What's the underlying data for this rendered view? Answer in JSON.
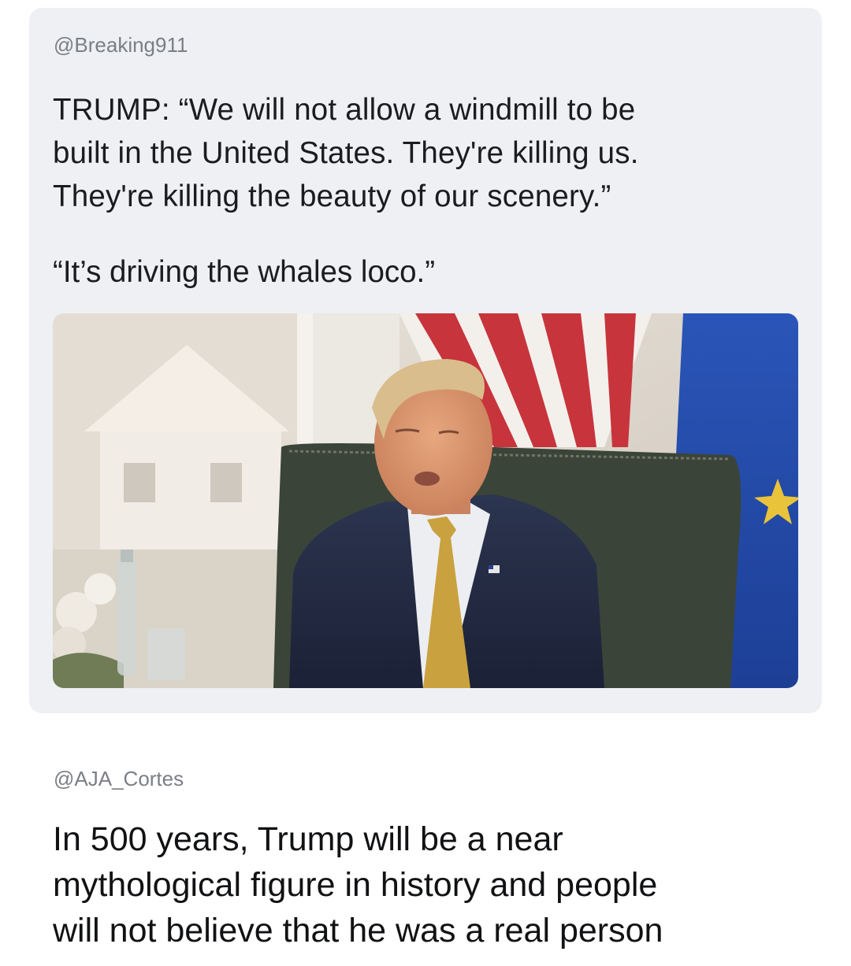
{
  "quoted_post": {
    "handle": "@Breaking911",
    "text_lines": [
      "TRUMP: “We will not allow a windmill to be",
      "built in the United States. They're killing us.",
      "They're killing the beauty of our scenery.”"
    ],
    "second_quote": "“It’s driving the whales loco.”",
    "media_description": "video-still"
  },
  "reply_post": {
    "handle": "@AJA_Cortes",
    "text_lines": [
      "In 500 years, Trump will be a near",
      "mythological figure in history and people",
      "will not believe that he was a real person"
    ]
  },
  "colors": {
    "card_background": "#eef0f3",
    "handle_gray": "#7a7f86",
    "text_dark": "#1a1c1f"
  }
}
